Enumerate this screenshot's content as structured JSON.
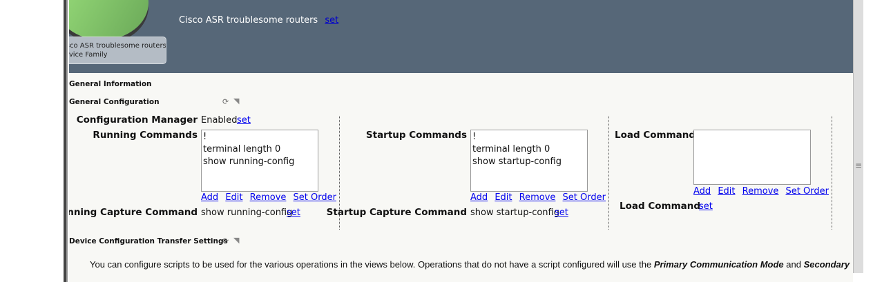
{
  "header": {
    "title": "Cisco ASR troublesome routers",
    "set_label": "set"
  },
  "family_card": {
    "name": "Cisco ASR troublesome routers",
    "type": "Device Family"
  },
  "sections": {
    "general_information": "General Information",
    "general_configuration": "General Configuration",
    "transfer_settings": "Device Configuration Transfer Settings"
  },
  "config": {
    "config_manager": {
      "label": "Configuration Manager",
      "value": "Enabled",
      "set": "set"
    },
    "running": {
      "label": "Running Commands",
      "items": [
        "!",
        "terminal length 0",
        "show running-config"
      ],
      "capture_label": "Running Capture Command",
      "capture_value": "show running-config",
      "set": "set"
    },
    "startup": {
      "label": "Startup Commands",
      "items": [
        "!",
        "terminal length 0",
        "show startup-config"
      ],
      "capture_label": "Startup Capture Command",
      "capture_value": "show startup-config",
      "set": "set"
    },
    "load": {
      "label": "Load Commands",
      "items": [],
      "command_label": "Load Command",
      "set": "set"
    },
    "actions": {
      "add": "Add",
      "edit": "Edit",
      "remove": "Remove",
      "set_order": "Set Order"
    }
  },
  "intro": {
    "text": "You can configure scripts to be used for the various operations in the views below. Operations that do not have a script configured will use the ",
    "mode1": "Primary Communication Mode",
    "and": " and ",
    "mode2": "Secondary"
  },
  "icons": {
    "refresh": "refresh-icon",
    "collapse": "collapse-icon",
    "grip": "scroll-grip-icon"
  }
}
